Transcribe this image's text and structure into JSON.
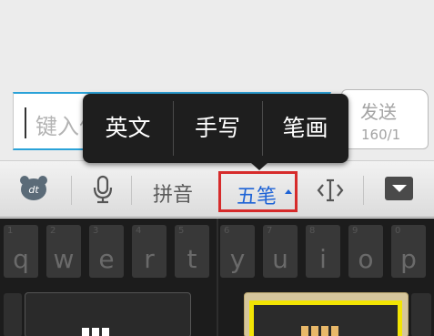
{
  "message": {
    "input_placeholder": "键入信息",
    "send_label": "发送",
    "char_count": "160/1"
  },
  "popup": {
    "items": [
      "英文",
      "手写",
      "笔画"
    ]
  },
  "toolbar": {
    "pinyin_label": "拼音",
    "wubi_label": "五笔",
    "icons": [
      "emoji-bear-icon",
      "microphone-icon",
      "cursor-move-icon",
      "keyboard-hide-icon"
    ]
  },
  "keyboard": {
    "keys": [
      {
        "num": "1",
        "letter": "q"
      },
      {
        "num": "2",
        "letter": "w"
      },
      {
        "num": "3",
        "letter": "e"
      },
      {
        "num": "4",
        "letter": "r"
      },
      {
        "num": "5",
        "letter": "t"
      },
      {
        "num": "6",
        "letter": "y"
      },
      {
        "num": "7",
        "letter": "u"
      },
      {
        "num": "8",
        "letter": "i"
      },
      {
        "num": "9",
        "letter": "o"
      },
      {
        "num": "0",
        "letter": "p"
      }
    ]
  },
  "colors": {
    "accent_blue": "#1e63d6",
    "highlight_red": "#d62b2b",
    "highlight_yellow": "#f2e404"
  }
}
